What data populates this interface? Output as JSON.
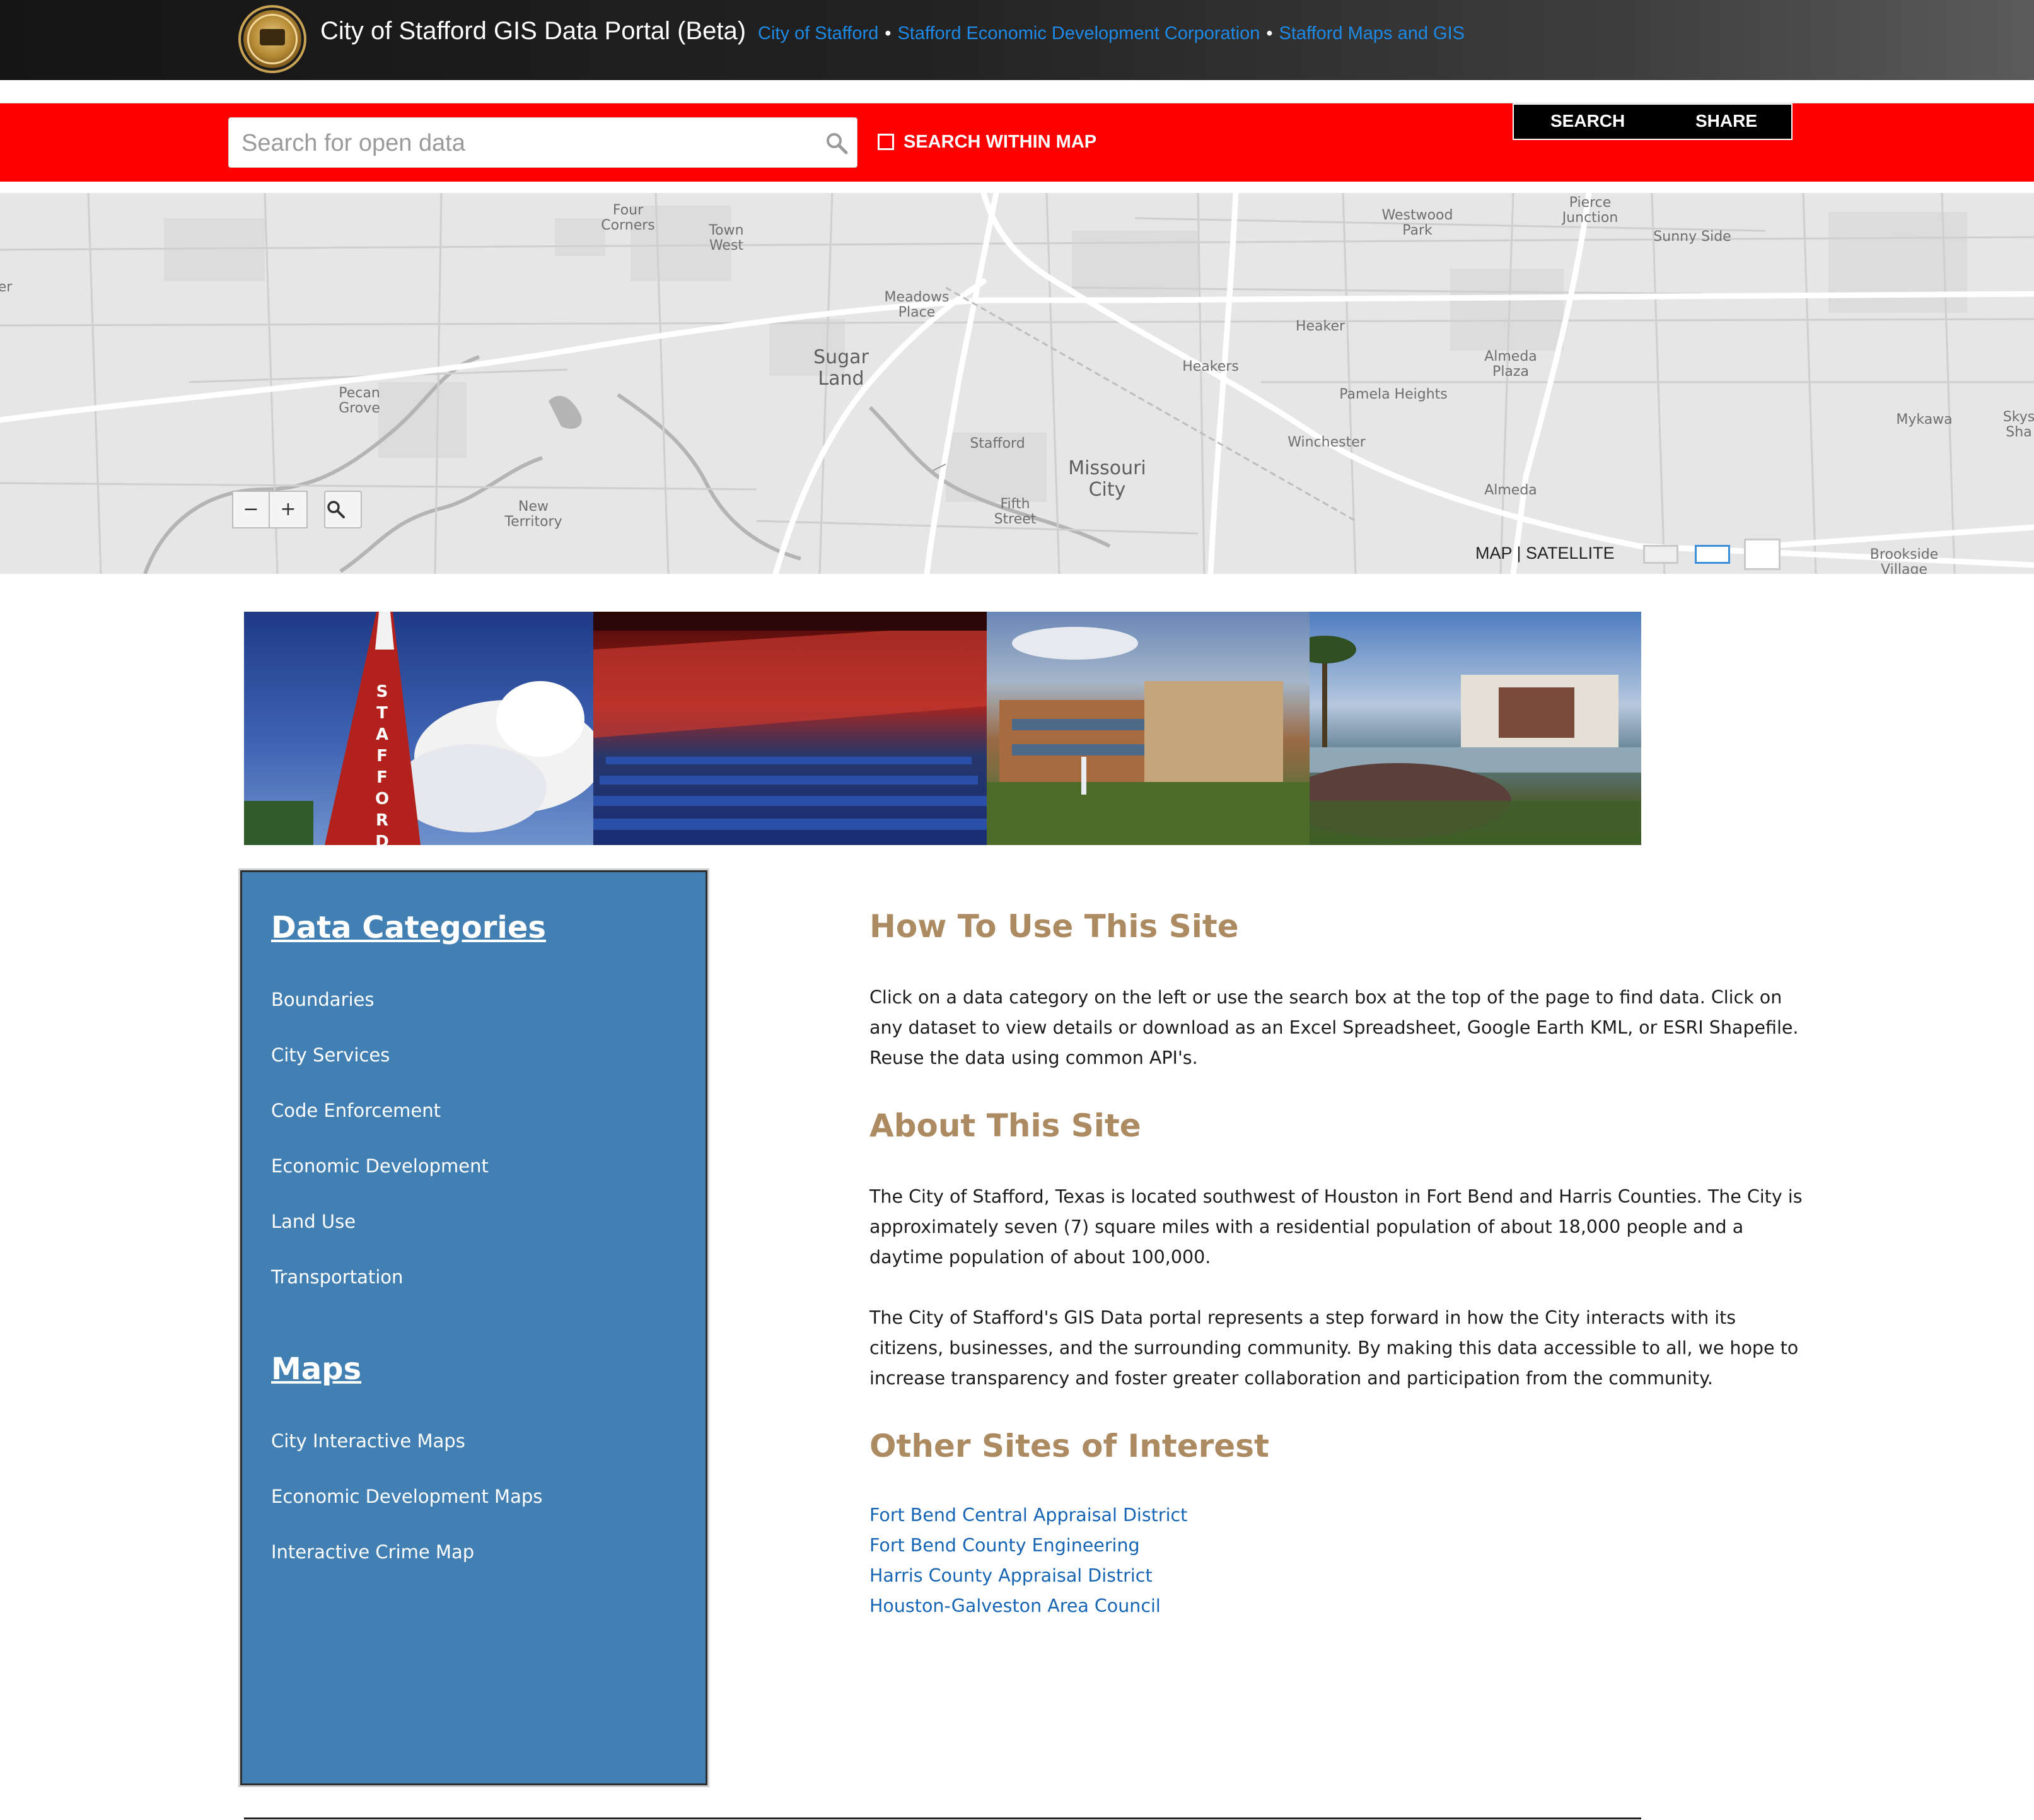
{
  "header": {
    "title": "City of Stafford GIS Data Portal (Beta)",
    "links": [
      {
        "label": "City of Stafford"
      },
      {
        "label": "Stafford Economic Development Corporation"
      },
      {
        "label": "Stafford Maps and GIS"
      }
    ],
    "separator": "•"
  },
  "search": {
    "placeholder": "Search for open data",
    "value": "",
    "within_map_label": "SEARCH WITHIN MAP",
    "search_button": "SEARCH",
    "share_button": "SHARE"
  },
  "map": {
    "labels": [
      {
        "text": "Four\nCorners"
      },
      {
        "text": "Town\nWest"
      },
      {
        "text": "Meadows\nPlace"
      },
      {
        "text": "Sugar\nLand"
      },
      {
        "text": "Pecan\nGrove"
      },
      {
        "text": "New\nTerritory"
      },
      {
        "text": "Stafford"
      },
      {
        "text": "Fifth\nStreet"
      },
      {
        "text": "Missouri\nCity"
      },
      {
        "text": "Westwood\nPark"
      },
      {
        "text": "Pierce\nJunction"
      },
      {
        "text": "Sunny Side"
      },
      {
        "text": "Heaker"
      },
      {
        "text": "Heakers"
      },
      {
        "text": "Almeda\nPlaza"
      },
      {
        "text": "Pamela Heights"
      },
      {
        "text": "Winchester"
      },
      {
        "text": "Almeda"
      },
      {
        "text": "Mykawa"
      },
      {
        "text": "Skys\nSha"
      },
      {
        "text": "Brookside\nVillage"
      },
      {
        "text": "er"
      }
    ],
    "zoom_out": "−",
    "zoom_in": "+",
    "toggle_label": "MAP | SATELLITE"
  },
  "banner": {
    "tower_text": "STAFFORD"
  },
  "sidebar": {
    "categories_heading": "Data Categories",
    "categories": [
      "Boundaries",
      "City Services",
      "Code Enforcement",
      "Economic Development",
      "Land Use",
      "Transportation"
    ],
    "maps_heading": "Maps",
    "maps": [
      "City Interactive Maps",
      "Economic Development Maps",
      "Interactive Crime Map"
    ]
  },
  "main": {
    "how_heading": "How To Use This Site",
    "how_text": "Click on a data category on the left or use the search box at the top of the page to find data. Click on any dataset to view details or download as an Excel Spreadsheet, Google Earth KML, or ESRI Shapefile. Reuse the data using common API's.",
    "about_heading": "About This Site",
    "about_text_1": "The City of Stafford, Texas is located southwest of Houston in Fort Bend and Harris Counties. The City is approximately seven (7) square miles with a residential population of about 18,000 people and a daytime population of about 100,000.",
    "about_text_2": "The City of Stafford's GIS Data portal represents a step forward in how the City interacts with its citizens, businesses, and the surrounding community. By making this data accessible to all, we hope to increase transparency and foster greater collaboration and participation from the community.",
    "other_heading": "Other Sites of Interest",
    "other_links": [
      "Fort Bend Central Appraisal District",
      "Fort Bend County Engineering",
      "Harris County Appraisal District",
      "Houston-Galveston Area Council"
    ]
  },
  "colors": {
    "red_bar": "#ff0000",
    "sidebar_blue": "#4280b3",
    "heading_tan": "#ad8b62",
    "link_blue": "#1565b4",
    "header_link_blue": "#1e8ae6"
  },
  "icons": [
    "city-seal-icon",
    "search-icon",
    "magnifier-icon"
  ]
}
